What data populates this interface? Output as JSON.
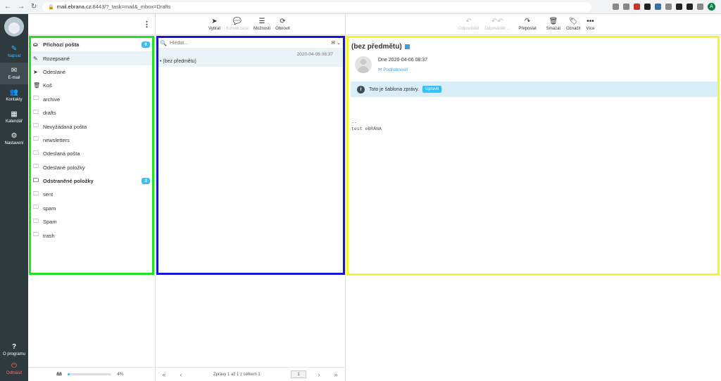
{
  "browser": {
    "url_host": "mail.ebrana.cz",
    "url_rest": ":8443/?_task=mail&_mbox=Drafts",
    "profile_initial": "A"
  },
  "iconbar": {
    "items": [
      {
        "label": "Napsat",
        "icon": "compose-icon"
      },
      {
        "label": "E-mail",
        "icon": "envelope-icon"
      },
      {
        "label": "Kontakty",
        "icon": "contacts-icon"
      },
      {
        "label": "Kalendář",
        "icon": "calendar-icon"
      },
      {
        "label": "Nastavení",
        "icon": "gear-icon"
      }
    ],
    "about_label": "O programu",
    "logout_label": "Odhlásit"
  },
  "folders": {
    "items": [
      {
        "label": "Příchozí pošta",
        "icon": "inbox-icon",
        "badge": "6"
      },
      {
        "label": "Rozepsané",
        "icon": "pencil-icon"
      },
      {
        "label": "Odeslané",
        "icon": "send-icon"
      },
      {
        "label": "Koš",
        "icon": "trash-icon"
      },
      {
        "label": "archive",
        "icon": "folder-icon"
      },
      {
        "label": "drafts",
        "icon": "folder-icon"
      },
      {
        "label": "Nevyžádaná pošta",
        "icon": "folder-icon"
      },
      {
        "label": "newsletters",
        "icon": "folder-icon"
      },
      {
        "label": "Odeslaná pošta",
        "icon": "folder-icon"
      },
      {
        "label": "Odeslané položky",
        "icon": "folder-icon"
      },
      {
        "label": "Odstraněné položky",
        "icon": "folder-icon",
        "badge": "3"
      },
      {
        "label": "sent",
        "icon": "folder-icon"
      },
      {
        "label": "spam",
        "icon": "folder-icon"
      },
      {
        "label": "Spam",
        "icon": "folder-icon"
      },
      {
        "label": "trash",
        "icon": "folder-icon"
      }
    ],
    "quota_percent": 4,
    "quota_label": "4%"
  },
  "list_toolbar": {
    "select": "Vybrat",
    "threads": "Konverzace",
    "options": "Možnosti",
    "refresh": "Obnovit"
  },
  "message_list": {
    "search_placeholder": "Hledat...",
    "messages": [
      {
        "date": "2020-04-06 08:37",
        "subject": "(bez předmětu)"
      }
    ],
    "pagination_text": "Zprávy 1 až 1 z celkem 1",
    "page": "1"
  },
  "preview_toolbar": {
    "reply": "Odpovědět",
    "reply_all": "Odpovědět ...",
    "forward": "Přeposlat",
    "delete": "Smazat",
    "mark": "Označit",
    "more": "Více"
  },
  "preview": {
    "subject": "(bez předmětu)",
    "date_line": "Dne 2020-04-06 08:37",
    "details_link": "Podrobnosti",
    "notice_text": "Toto je šablona zprávy.",
    "edit_button": "Upravit",
    "body": "--\ntest eBRÁNA"
  }
}
